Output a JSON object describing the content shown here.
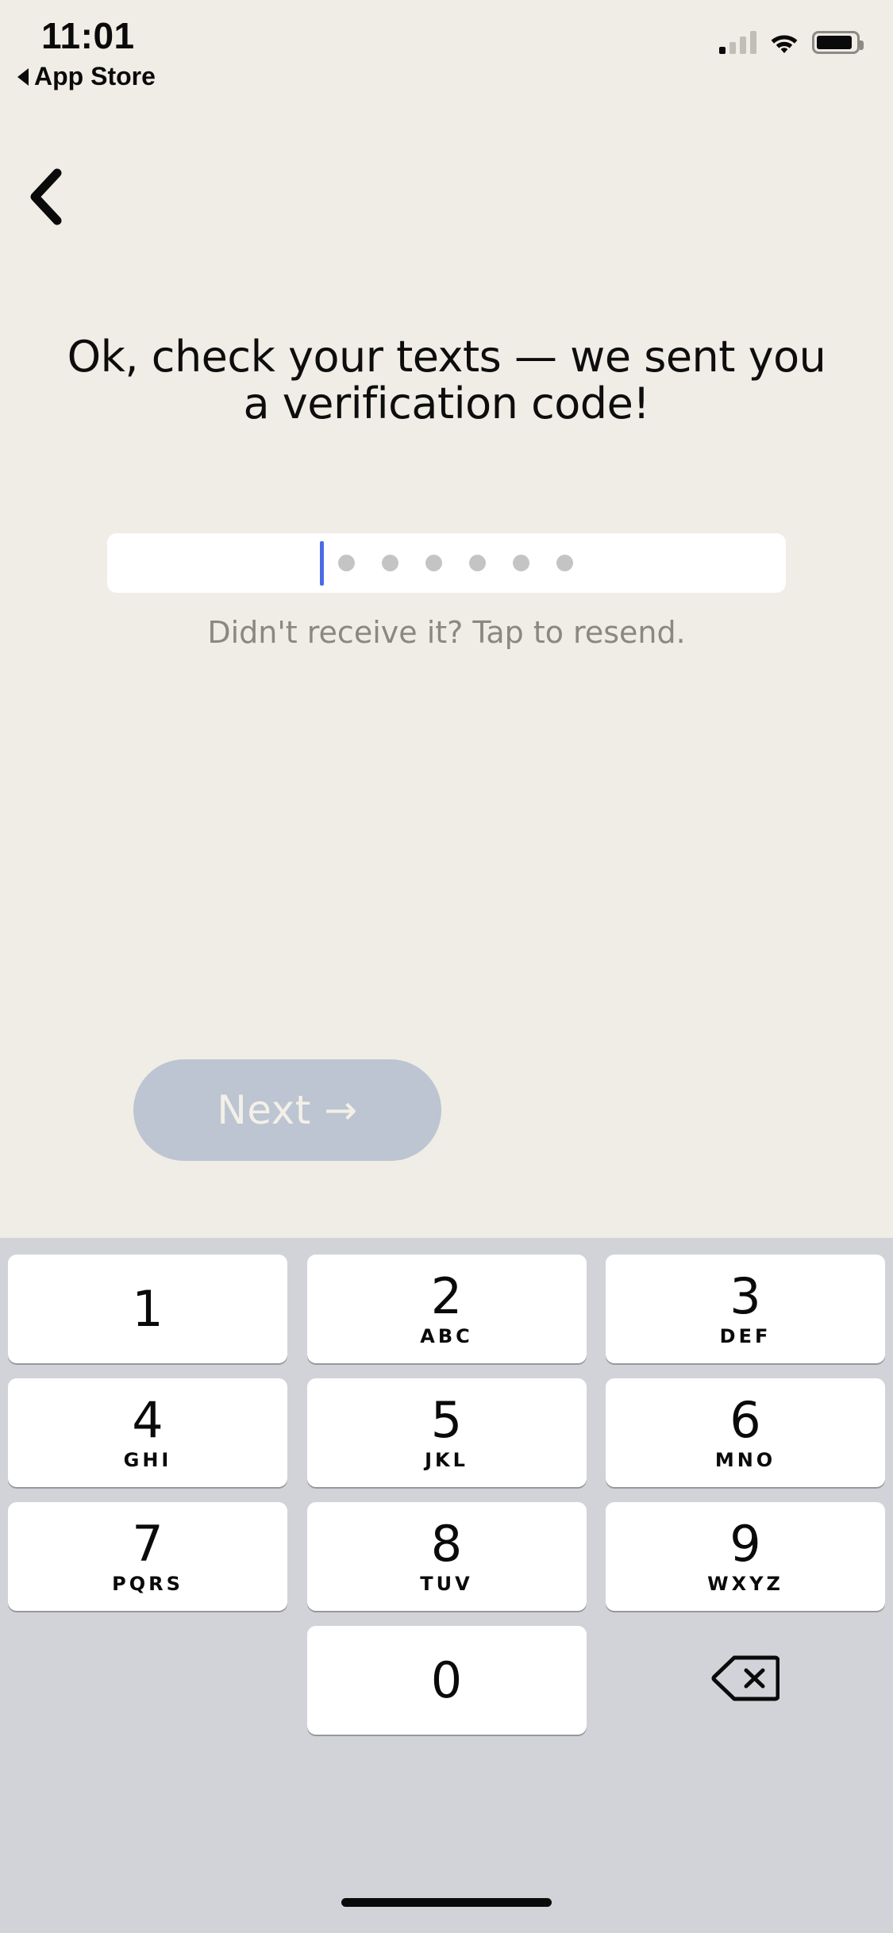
{
  "status_bar": {
    "time": "11:01",
    "back_app_label": "App Store",
    "back_triangle_icon": "triangle-left-icon",
    "signal_icon": "cellular-signal-icon",
    "wifi_icon": "wifi-icon",
    "battery_icon": "battery-icon"
  },
  "nav": {
    "back_icon": "chevron-left-icon"
  },
  "content": {
    "heading": "Ok, check your texts — we sent you a verification code!",
    "resend_text": "Didn't receive it? Tap to resend.",
    "code_dot_count": 6,
    "caret_color": "#4A6BE8",
    "dot_color": "#C4C4C4",
    "field_background": "#FFFFFF"
  },
  "next_button": {
    "label": "Next →",
    "background": "#BCC5D1",
    "text_color": "#F3F0E8",
    "enabled": false
  },
  "keyboard": {
    "background": "#D1D3D8",
    "key_background": "#FFFFFF",
    "rows": [
      [
        {
          "digit": "1",
          "letters": ""
        },
        {
          "digit": "2",
          "letters": "ABC"
        },
        {
          "digit": "3",
          "letters": "DEF"
        }
      ],
      [
        {
          "digit": "4",
          "letters": "GHI"
        },
        {
          "digit": "5",
          "letters": "JKL"
        },
        {
          "digit": "6",
          "letters": "MNO"
        }
      ],
      [
        {
          "digit": "7",
          "letters": "PQRS"
        },
        {
          "digit": "8",
          "letters": "TUV"
        },
        {
          "digit": "9",
          "letters": "WXYZ"
        }
      ]
    ],
    "bottom_row": {
      "zero_digit": "0",
      "backspace_icon": "backspace-delete-icon"
    }
  },
  "theme": {
    "page_background": "#F0EDE6",
    "text_color": "#0D0D0D",
    "muted_text_color": "#8A8880"
  },
  "home_indicator": {
    "icon": "home-indicator-bar"
  }
}
